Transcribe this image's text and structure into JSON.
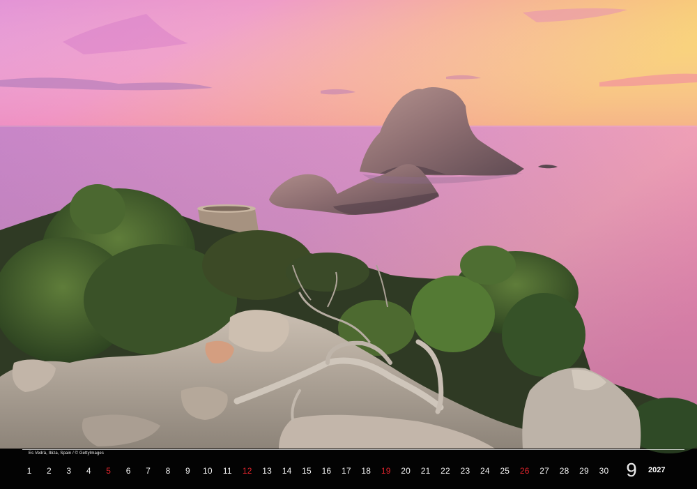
{
  "photo": {
    "subject": "Es Vedrà rock islets at sunset with coastal cliff and pine trees",
    "colors": {
      "sky_top": "#e89ad0",
      "sky_mid": "#f2a0b8",
      "sky_glow": "#f8d070",
      "sea": "#d890c8",
      "rock": "#8a6a6a",
      "pine": "#3a5a2a"
    }
  },
  "caption": "Es Vedrà, Ibiza, Spain / © GettyImages",
  "calendar": {
    "month": "9",
    "year": "2027",
    "days": [
      "1",
      "2",
      "3",
      "4",
      "5",
      "6",
      "7",
      "8",
      "9",
      "10",
      "11",
      "12",
      "13",
      "14",
      "15",
      "16",
      "17",
      "18",
      "19",
      "20",
      "21",
      "22",
      "23",
      "24",
      "25",
      "26",
      "27",
      "28",
      "29",
      "30"
    ],
    "sundays": [
      "5",
      "12",
      "19",
      "26"
    ],
    "sunday_color": "#e0242c"
  }
}
